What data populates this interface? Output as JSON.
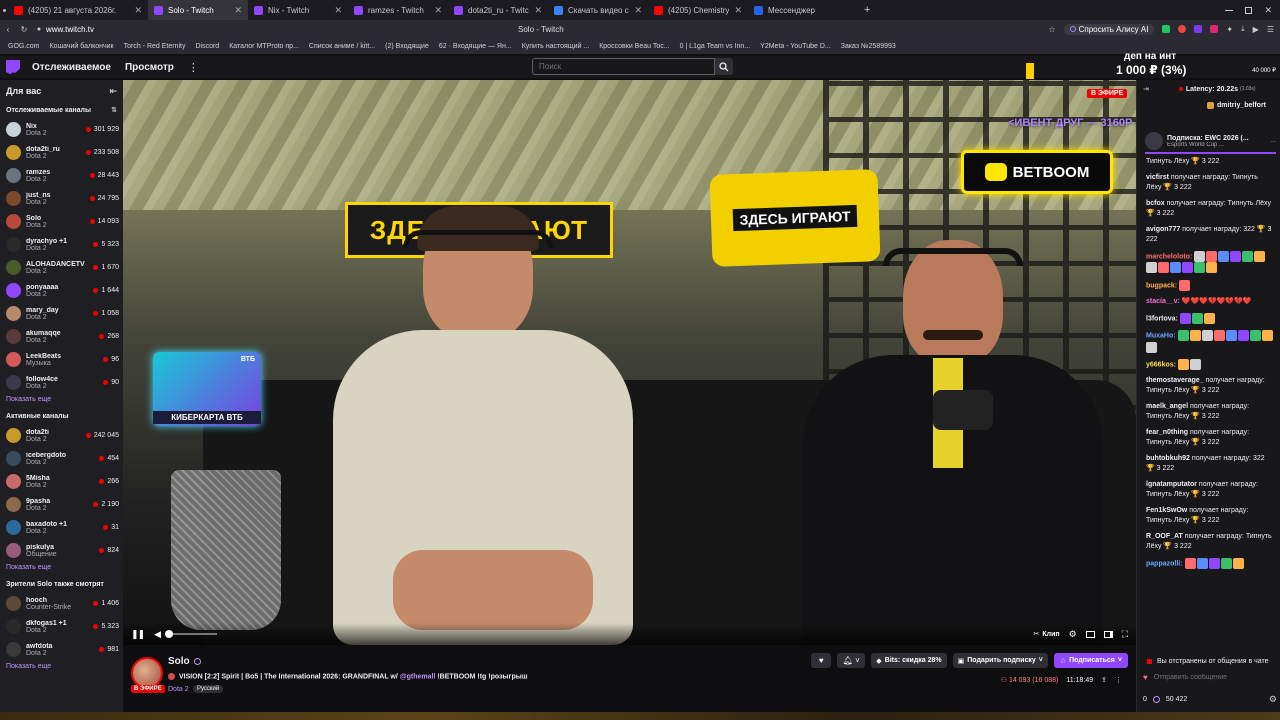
{
  "browser": {
    "tabs": [
      {
        "label": "(4205) 21 августа 2026г.",
        "color": "#ff0000",
        "active": false
      },
      {
        "label": "Solo - Twitch",
        "color": "#9146ff",
        "active": true
      },
      {
        "label": "Nix - Twitch",
        "color": "#9146ff",
        "active": false
      },
      {
        "label": "ramzes - Twitch",
        "color": "#9146ff",
        "active": false
      },
      {
        "label": "dota2ti_ru - Twitch",
        "color": "#9146ff",
        "active": false
      },
      {
        "label": "Скачать видео с Ютуба б...",
        "color": "#3b82f6",
        "active": false
      },
      {
        "label": "(4205) Chemistry 🌐 👏",
        "color": "#ff0000",
        "active": false
      },
      {
        "label": "Мессенджер",
        "color": "#2563eb",
        "active": false
      }
    ],
    "tab_plus": "+",
    "url": "www.twitch.tv",
    "page_title": "Solo - Twitch",
    "ask_alisa": "Спросить Алису AI",
    "bookmarks": [
      "GOG.com",
      "Кошачий балкончик",
      "Torch - Red Eternity",
      "Discord",
      "Каталог MTProto пр...",
      "Список аниме / kitt...",
      "(2) Входящие",
      "62 · Входящие — Ян...",
      "Купить настоящий ...",
      "Кроссовки Beau Toc...",
      "0 | L1ga Team vs Inn...",
      "Y2Meta - YouTube D...",
      "Заказ №2589993"
    ]
  },
  "twitch_nav": {
    "following": "Отслеживаемое",
    "browse": "Просмотр",
    "more": "⋮",
    "search_placeholder": "Поиск",
    "search_button": "⌕"
  },
  "sidebar": {
    "title": "Для вас",
    "followed_title": "Отслеживаемые каналы",
    "followed": [
      {
        "name": "Nix",
        "game": "Dota 2",
        "viewers": "301 929",
        "color": "#c9d1d9"
      },
      {
        "name": "dota2ti_ru",
        "game": "Dota 2",
        "viewers": "233 508",
        "color": "#c89a2a"
      },
      {
        "name": "ramzes",
        "game": "Dota 2",
        "viewers": "28 443",
        "color": "#6b7280"
      },
      {
        "name": "just_ns",
        "game": "Dota 2",
        "viewers": "24 795",
        "color": "#7c4a2a"
      },
      {
        "name": "Solo",
        "game": "Dota 2",
        "viewers": "14 093",
        "color": "#b54a3a"
      },
      {
        "name": "dyrachyo +1",
        "game": "Dota 2",
        "viewers": "5 323",
        "color": "#2a2a2a"
      },
      {
        "name": "ALOHADANCETV",
        "game": "Dota 2",
        "viewers": "1 670",
        "color": "#4a5a2a"
      },
      {
        "name": "ponyaaaa",
        "game": "Dota 2",
        "viewers": "1 644",
        "color": "#9146ff"
      },
      {
        "name": "mary_day",
        "game": "Dota 2",
        "viewers": "1 058",
        "color": "#b88a6a"
      },
      {
        "name": "akumaqqe",
        "game": "Dota 2",
        "viewers": "268",
        "color": "#5a3a3a"
      },
      {
        "name": "LeekBeats",
        "game": "Музыка",
        "viewers": "96",
        "color": "#d45a5a"
      },
      {
        "name": "follow4ce",
        "game": "Dota 2",
        "viewers": "90",
        "color": "#3a3a4a"
      }
    ],
    "show_more": "Показать еще",
    "active_title": "Активные каналы",
    "active": [
      {
        "name": "dota2ti",
        "game": "Dota 2",
        "viewers": "242 045",
        "color": "#c89a2a"
      },
      {
        "name": "icebergdoto",
        "game": "Dota 2",
        "viewers": "454",
        "color": "#3a4a5a"
      },
      {
        "name": "5Misha",
        "game": "Dota 2",
        "viewers": "266",
        "color": "#c86a6a"
      },
      {
        "name": "9pasha",
        "game": "Dota 2",
        "viewers": "2 190",
        "color": "#8a6a4a"
      },
      {
        "name": "baxadoto +1",
        "game": "Dota 2",
        "viewers": "31",
        "color": "#2a6a9a"
      },
      {
        "name": "piskulya",
        "game": "Общение",
        "viewers": "824",
        "color": "#9a5a7a"
      }
    ],
    "also_title": "Зрители Solo также смотрят",
    "also": [
      {
        "name": "hooch",
        "game": "Counter-Strike",
        "viewers": "1 406",
        "color": "#5a4a3a"
      },
      {
        "name": "dkfogas1 +1",
        "game": "Dota 2",
        "viewers": "5 323",
        "color": "#2a2a2a"
      },
      {
        "name": "awfdota",
        "game": "Dota 2",
        "viewers": "981",
        "color": "#3a3a3a"
      }
    ]
  },
  "player": {
    "live_badge": "В ЭФИРЕ",
    "overlay_money": "1 000 ₽ (3%)",
    "overlay_goal": "деп на инт",
    "overlay_goal_amount": "40 000 ₽",
    "overlay_ticker": "<ИВЕНТ ДРУГ — 3160Р  наруто",
    "betboom": "BETBOOM",
    "banner_left": "ЗДЕСЬ ИГРАЮТ",
    "pillow_text": "ЗДЕСЬ ИГРАЮТ",
    "vtb_card": "КИБЕРКАРТА ВТБ",
    "vtb_logo": "ВТБ",
    "clip": "Клип"
  },
  "stream": {
    "name": "Solo",
    "live": "В ЭФИРЕ",
    "title": "VISION [2:2] Spirit | Bo5 | The International 2026: GRANDFINAL w/",
    "mention": "@gthemall",
    "title_tail": "!BETBOOM !tg !розыгрыш",
    "game": "Dota 2",
    "tag": "Русский",
    "bits": "Bits: скидка 28%",
    "gift": "Подарить подписку",
    "subscribe": "Подписаться",
    "viewers": "14 093 (16 088)",
    "uptime": "11:18:49"
  },
  "chat": {
    "latency": "Latency: 20.22s",
    "latency_sub": "(1.03s)",
    "pinned_user": "dmitriy_belfort",
    "sub_title": "Подписка: EWC 2026 (...",
    "sub_sub": "Esports World Cup ...",
    "sub_link": "...",
    "messages": [
      {
        "user": "",
        "text": "Типнуть Лёху 🏆 3 222",
        "color": "#efeff1"
      },
      {
        "user": "vicfirst",
        "text": "получает награду: Типнуть Лёху 🏆 3 222",
        "color": "#efeff1"
      },
      {
        "user": "bcfox",
        "text": "получает награду: Типнуть Лёху 🏆 3 222",
        "color": "#efeff1"
      },
      {
        "user": "avigon777",
        "text": "получает награду: 322 🏆 3 222",
        "color": "#efeff1"
      },
      {
        "user": "marcheloloto:",
        "text": "",
        "color": "#ff6b6b",
        "emotes": 12
      },
      {
        "user": "bugpack:",
        "text": "",
        "color": "#ffb14a",
        "emotes": 1
      },
      {
        "user": "stacia__v:",
        "text": "❤️❤️❤️💔❤️💔💔❤️",
        "color": "#ff6bd5"
      },
      {
        "user": "l3fortova:",
        "text": "",
        "color": "#efeff1",
        "emotes": 3
      },
      {
        "user": "MuxaHo:",
        "text": "",
        "color": "#6ba8ff",
        "emotes": 9
      },
      {
        "user": "y666kos:",
        "text": "",
        "color": "#ffdf4a",
        "emotes": 2
      },
      {
        "user": "themostaverage_",
        "text": "получает награду: Типнуть Лёху 🏆 3 222",
        "color": "#efeff1"
      },
      {
        "user": "maelk_angel",
        "text": "получает награду: Типнуть Лёху 🏆 3 222",
        "color": "#efeff1"
      },
      {
        "user": "fear_n0thing",
        "text": "получает награду: Типнуть Лёху 🏆 3 222",
        "color": "#efeff1"
      },
      {
        "user": "buhtobkuh92",
        "text": "получает награду: 322 🏆 3 222",
        "color": "#efeff1"
      },
      {
        "user": "lgnatamputator",
        "text": "получает награду: Типнуть Лёху 🏆 3 222",
        "color": "#efeff1"
      },
      {
        "user": "Fen1kSwOw",
        "text": "получает награду: Типнуть Лёху 🏆 3 222",
        "color": "#efeff1"
      },
      {
        "user": "R_OOF_AT",
        "text": "получает награду: Типнуть Лёху 🏆 3 222",
        "color": "#efeff1"
      },
      {
        "user": "pappazolli:",
        "text": "",
        "color": "#6ba8ff",
        "emotes": 5
      }
    ],
    "timeout_notice": "Вы отстранены от общения в чате",
    "input_placeholder": "Отправить сообщение",
    "points": "50 422",
    "points_zero": "0"
  }
}
